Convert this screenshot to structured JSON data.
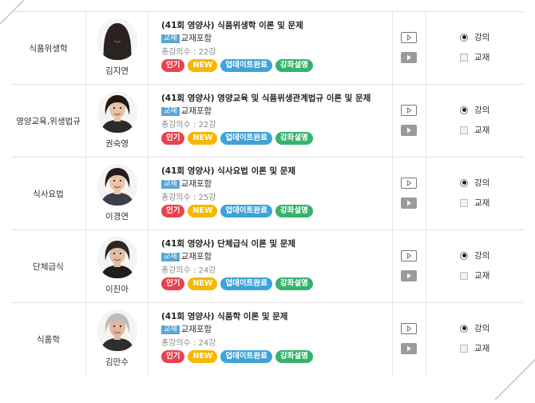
{
  "rows": [
    {
      "subject": "식품위생학",
      "professor": "김지연",
      "title": "(41회 영양사) 식품위생학 이론 및 문제",
      "material_tag": "교재",
      "material_text": "교재포함",
      "count": "총강의수 : 22강",
      "badges": [
        "인기",
        "NEW",
        "업데이트완료",
        "강좌설명"
      ],
      "opt_lecture": "강의",
      "opt_book": "교재"
    },
    {
      "subject": "영양교육,위생법규",
      "professor": "권숙영",
      "title": "(41회 영양사) 영양교육 및 식품위생관계법규 이론 및 문제",
      "material_tag": "교재",
      "material_text": "교재포함",
      "count": "총강의수 : 22강",
      "badges": [
        "인기",
        "NEW",
        "업데이트완료",
        "강좌설명"
      ],
      "opt_lecture": "강의",
      "opt_book": "교재"
    },
    {
      "subject": "식사요법",
      "professor": "이경연",
      "title": "(41회 영양사) 식사요법 이론 및 문제",
      "material_tag": "교재",
      "material_text": "교재포함",
      "count": "총강의수 : 25강",
      "badges": [
        "인기",
        "NEW",
        "업데이트완료",
        "강좌설명"
      ],
      "opt_lecture": "강의",
      "opt_book": "교재"
    },
    {
      "subject": "단체급식",
      "professor": "이진아",
      "title": "(41회 영양사) 단체급식 이론 및 문제",
      "material_tag": "교재",
      "material_text": "교재포함",
      "count": "총강의수 : 24강",
      "badges": [
        "인기",
        "NEW",
        "업데이트완료",
        "강좌설명"
      ],
      "opt_lecture": "강의",
      "opt_book": "교재"
    },
    {
      "subject": "식품학",
      "professor": "김만수",
      "title": "(41회 영양사) 식품학 이론 및 문제",
      "material_tag": "교재",
      "material_text": "교재포함",
      "count": "총강의수 : 24강",
      "badges": [
        "인기",
        "NEW",
        "업데이트완료",
        "강좌설명"
      ],
      "opt_lecture": "강의",
      "opt_book": "교재"
    }
  ],
  "colors": {
    "hot": "#e8434d",
    "new": "#f5b700",
    "updated": "#3fa3d8",
    "explain": "#35b36b",
    "material_tag": "#5aa6d6"
  },
  "icons": [
    "play-preview-icon",
    "play-video-icon",
    "professor-photo"
  ],
  "selected_option": "강의"
}
